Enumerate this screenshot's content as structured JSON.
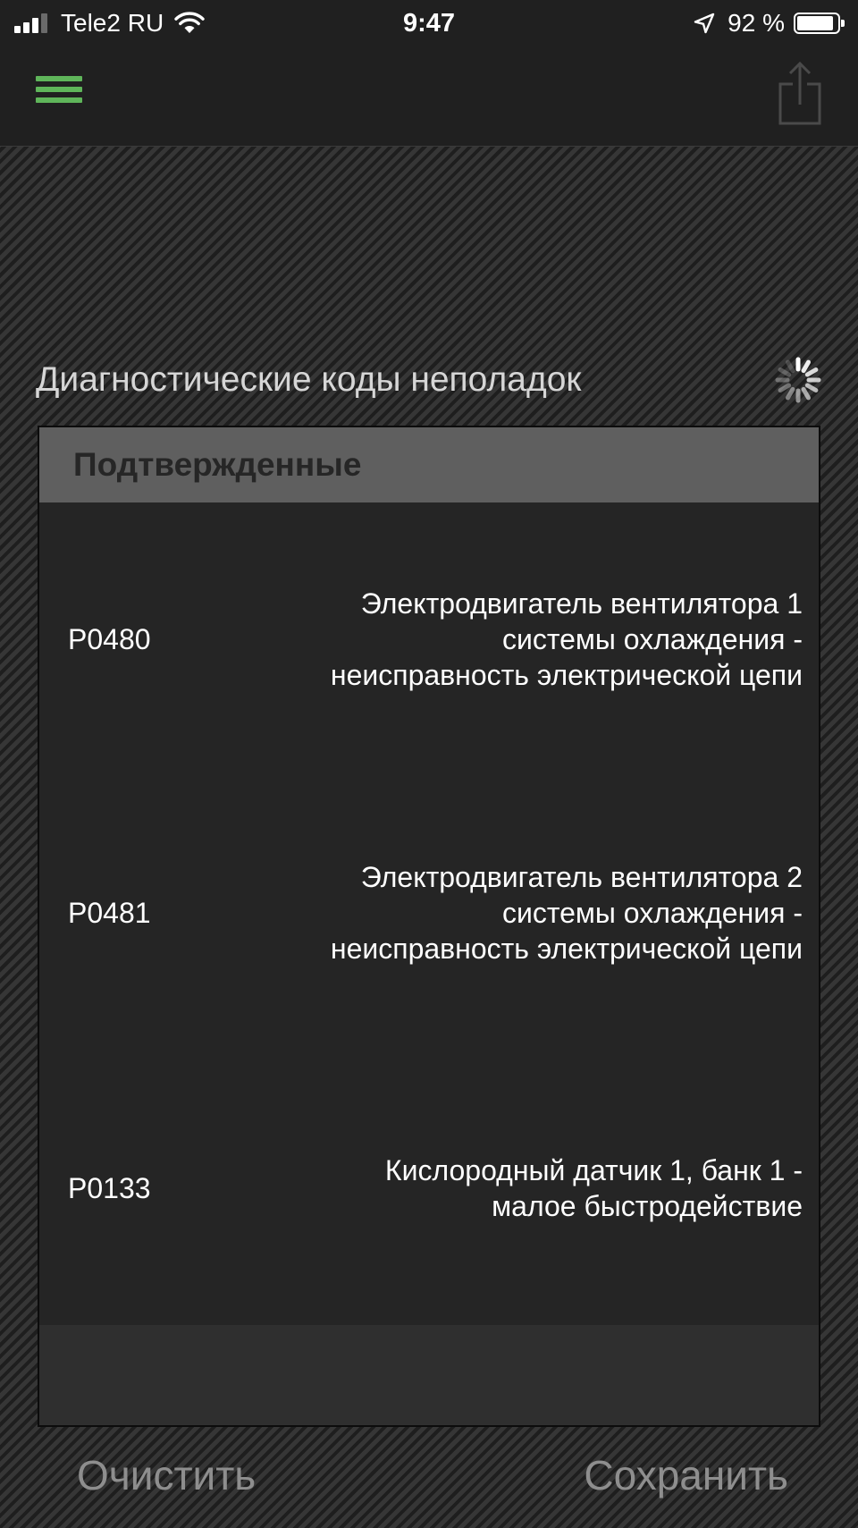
{
  "status_bar": {
    "carrier": "Tele2 RU",
    "time": "9:47",
    "battery_percent": "92 %",
    "battery_level": 0.92,
    "icons": [
      "signal-icon",
      "wifi-icon",
      "location-arrow-icon",
      "battery-icon"
    ]
  },
  "nav": {
    "menu_icon": "hamburger-menu-icon",
    "share_icon": "share-icon",
    "accent_color": "#5fb55a"
  },
  "section": {
    "title": "Диагностические коды неполадок",
    "loading_icon": "spinner-icon"
  },
  "panel": {
    "header": "Подтвержденные",
    "codes": [
      {
        "code": "P0480",
        "description": "Электродвигатель вентилятора 1\nсистемы охлаждения -\nнеисправность электрической цепи"
      },
      {
        "code": "P0481",
        "description": "Электродвигатель вентилятора 2\nсистемы охлаждения -\nнеисправность электрической цепи"
      },
      {
        "code": "P0133",
        "description": "Кислородный датчик 1, банк 1 -\nмалое быстродействие"
      }
    ]
  },
  "actions": {
    "clear_label": "Очистить",
    "save_label": "Сохранить"
  }
}
